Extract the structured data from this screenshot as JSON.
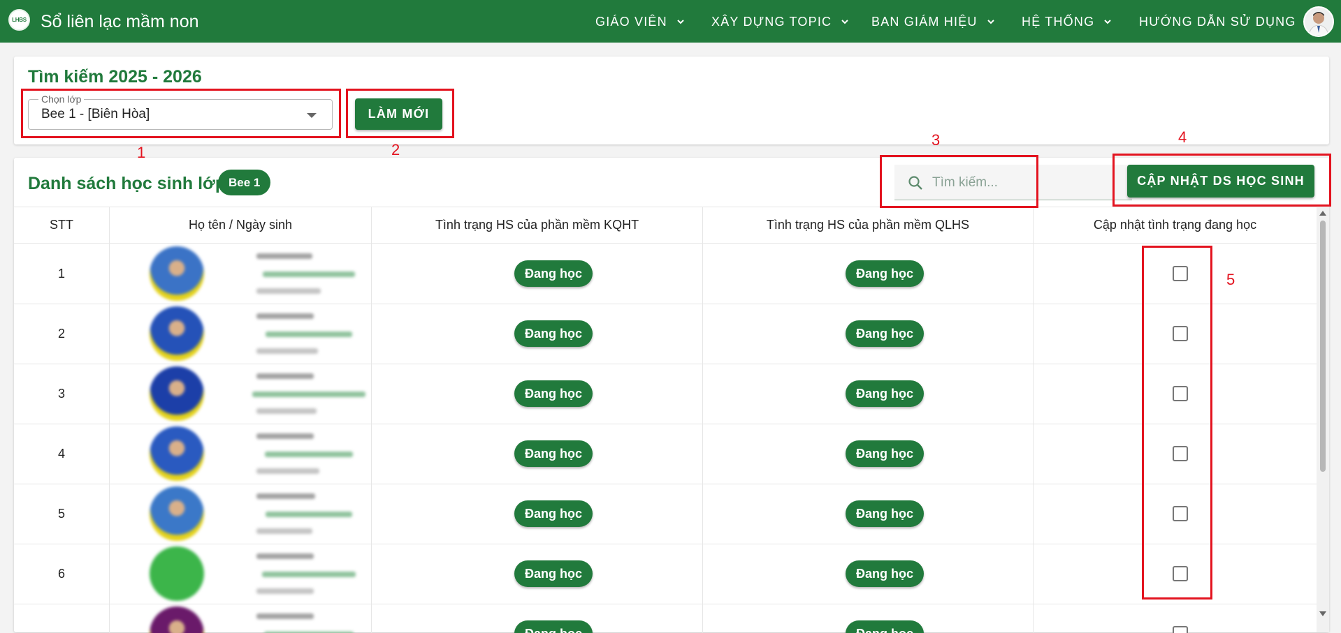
{
  "app": {
    "title": "Sổ liên lạc mầm non",
    "logo_text": "LHBS"
  },
  "nav": [
    {
      "label": "GIÁO VIÊN",
      "has_dropdown": true
    },
    {
      "label": "XÂY DỰNG TOPIC",
      "has_dropdown": true
    },
    {
      "label": "BAN GIÁM HIỆU",
      "has_dropdown": true
    },
    {
      "label": "HỆ THỐNG",
      "has_dropdown": true
    },
    {
      "label": "HƯỚNG DẪN SỬ DỤNG",
      "has_dropdown": false
    }
  ],
  "search_card": {
    "title": "Tìm kiếm 2025 - 2026",
    "class_select": {
      "legend": "Chọn lớp",
      "value": "Bee 1 - [Biên Hòa]"
    },
    "refresh_label": "LÀM MỚI"
  },
  "list_card": {
    "title": "Danh sách học sinh lớp",
    "class_chip": "Bee 1",
    "search": {
      "placeholder": "Tìm kiếm...",
      "value": ""
    },
    "update_button": "CẬP NHẬT DS HỌC SINH"
  },
  "table": {
    "headers": [
      "STT",
      "Họ tên / Ngày sinh",
      "Tình trạng HS của phần mềm KQHT",
      "Tình trạng HS của phần mềm QLHS",
      "Cập nhật tình trạng đang học"
    ],
    "rows": [
      {
        "stt": "1",
        "kqht": "Đang học",
        "qlhs": "Đang học",
        "checked": false,
        "avatar_color": "#3b73c6"
      },
      {
        "stt": "2",
        "kqht": "Đang học",
        "qlhs": "Đang học",
        "checked": false,
        "avatar_color": "#2552b8"
      },
      {
        "stt": "3",
        "kqht": "Đang học",
        "qlhs": "Đang học",
        "checked": false,
        "avatar_color": "#1c3fa8"
      },
      {
        "stt": "4",
        "kqht": "Đang học",
        "qlhs": "Đang học",
        "checked": false,
        "avatar_color": "#2a5ac0"
      },
      {
        "stt": "5",
        "kqht": "Đang học",
        "qlhs": "Đang học",
        "checked": false,
        "avatar_color": "#3b78c8"
      },
      {
        "stt": "6",
        "kqht": "Đang học",
        "qlhs": "Đang học",
        "checked": false,
        "avatar_color": "#3cb54a"
      },
      {
        "stt": "",
        "kqht": "Đang học",
        "qlhs": "Đang học",
        "checked": false,
        "avatar_color": "#6a1a6a"
      }
    ]
  },
  "annotations": [
    "1",
    "2",
    "3",
    "4",
    "5"
  ],
  "colors": {
    "brand": "#217a3c",
    "annotation": "#e3131f"
  }
}
